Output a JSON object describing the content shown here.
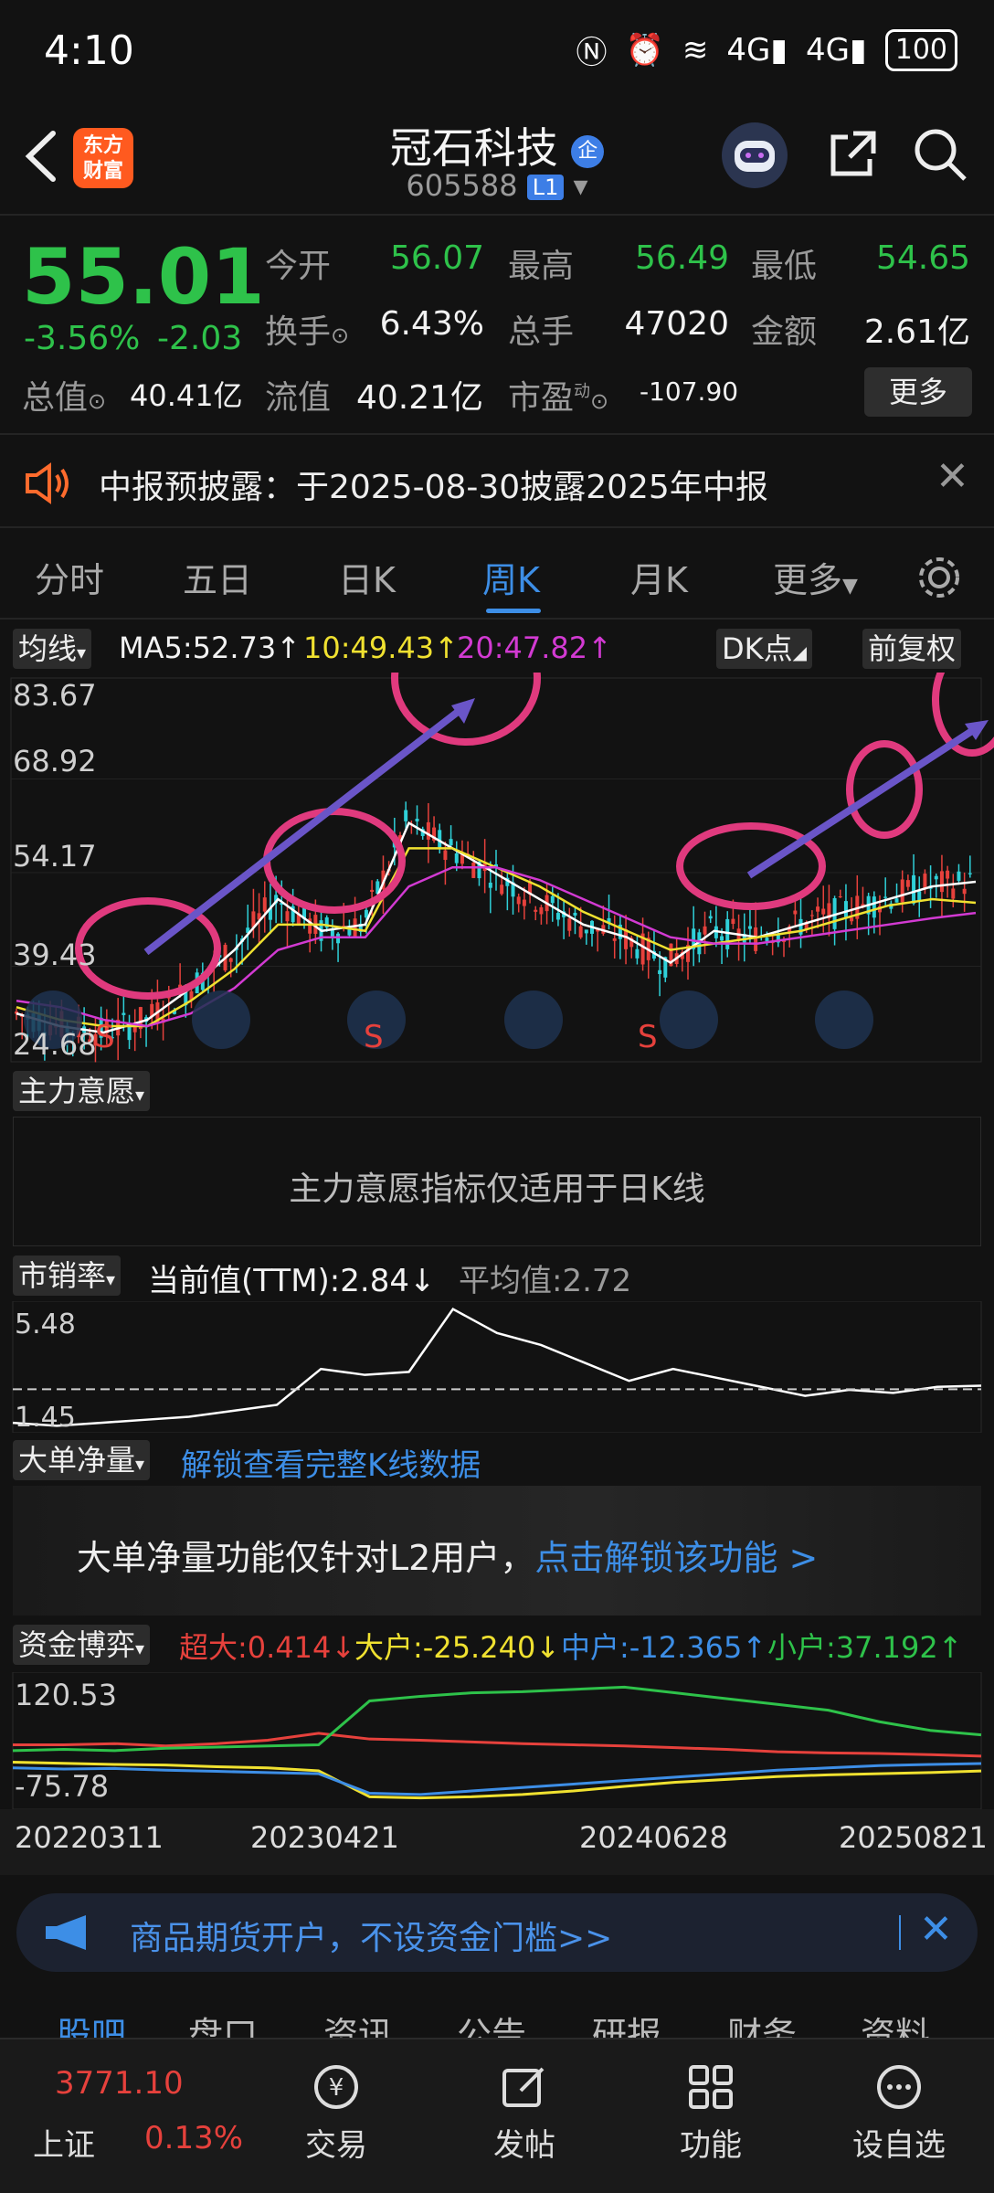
{
  "status": {
    "time": "4:10",
    "battery": "100",
    "network1": "4G",
    "network2": "4G"
  },
  "header": {
    "app_logo": "东方\n财富",
    "stock_name": "冠石科技",
    "stock_badge": "企",
    "stock_code": "605588",
    "level": "L1"
  },
  "quote": {
    "price": "55.01",
    "pct": "-3.56%",
    "change": "-2.03",
    "open_label": "今开",
    "open": "56.07",
    "high_label": "最高",
    "high": "56.49",
    "low_label": "最低",
    "low": "54.65",
    "turnover_label": "换手",
    "turnover": "6.43%",
    "volume_label": "总手",
    "volume": "47020",
    "amount_label": "金额",
    "amount": "2.61亿",
    "mktcap_label": "总值",
    "mktcap": "40.41亿",
    "float_label": "流值",
    "float_cap": "40.21亿",
    "pe_label": "市盈",
    "pe_sup": "动",
    "pe": "-107.90",
    "more": "更多"
  },
  "notice": {
    "text": "中报预披露：于2025-08-30披露2025年中报"
  },
  "tabs": [
    "分时",
    "五日",
    "日K",
    "周K",
    "月K",
    "更多"
  ],
  "chart": {
    "ma_label": "均线",
    "ma5": "MA5:52.73↑",
    "ma10": "10:49.43↑",
    "ma20": "20:47.82↑",
    "dk_label": "DK点",
    "adjust_label": "前复权",
    "y_ticks": [
      "83.67",
      "68.92",
      "54.17",
      "39.43",
      "24.68"
    ],
    "colors": {
      "up": "#e6413c",
      "down": "#2fd0d8",
      "ma5": "#ffffff",
      "ma10": "#f0e130",
      "ma20": "#d23ad2",
      "annotation": "#e03a7e",
      "arrow": "#6a55c8"
    }
  },
  "chart_data": {
    "type": "line",
    "title": "",
    "xlabel": "",
    "ylabel": "",
    "ylim": [
      24.68,
      83.67
    ],
    "series": [
      {
        "name": "MA5",
        "values": [
          32,
          30,
          29,
          31,
          36,
          42,
          50,
          45,
          46,
          62,
          58,
          54,
          50,
          46,
          44,
          40,
          45,
          44,
          46,
          48,
          50,
          52,
          52.73
        ]
      },
      {
        "name": "10",
        "values": [
          33,
          31,
          30,
          30,
          34,
          39,
          46,
          46,
          45,
          58,
          58,
          55,
          52,
          48,
          45,
          42,
          43,
          44,
          45,
          47,
          49,
          50,
          49.43
        ]
      },
      {
        "name": "20",
        "values": [
          34,
          33,
          31,
          30,
          32,
          36,
          42,
          44,
          44,
          52,
          55,
          55,
          53,
          50,
          47,
          44,
          43,
          43,
          44,
          45,
          46,
          47,
          47.82
        ]
      }
    ]
  },
  "zhuli": {
    "label": "主力意愿",
    "message": "主力意愿指标仅适用于日K线"
  },
  "ps": {
    "label": "市销率",
    "current": "当前值(TTM):2.84↓",
    "average": "平均值:2.72",
    "y_top": "5.48",
    "y_bottom": "1.45"
  },
  "ps_data": {
    "values": [
      1.6,
      1.5,
      1.6,
      1.7,
      1.8,
      2.0,
      2.2,
      3.4,
      3.2,
      3.3,
      5.4,
      4.6,
      4.2,
      3.6,
      3.0,
      3.4,
      3.1,
      2.8,
      2.5,
      2.7,
      2.6,
      2.8,
      2.84
    ],
    "average": 2.72
  },
  "bigorder": {
    "label": "大单净量",
    "unlock_link": "解锁查看完整K线数据",
    "message": "大单净量功能仅针对L2用户，",
    "message_link": "点击解锁该功能 >"
  },
  "capital": {
    "label": "资金博弈",
    "super": "超大:0.414↓",
    "large": "大户:-25.240↓",
    "mid": "中户:-12.365↑",
    "small": "小户:37.192↑",
    "y_top": "120.53",
    "y_bottom": "-75.78",
    "dates": [
      "20220311",
      "20230421",
      "20240628",
      "20250821"
    ]
  },
  "capital_data": {
    "series": [
      {
        "name": "超大",
        "values": [
          20,
          20,
          22,
          18,
          22,
          28,
          40,
          30,
          28,
          25,
          22,
          20,
          18,
          15,
          12,
          8,
          6,
          5,
          3,
          0.414
        ]
      },
      {
        "name": "大户",
        "values": [
          -10,
          -12,
          -14,
          -15,
          -18,
          -20,
          -25,
          -70,
          -72,
          -70,
          -66,
          -60,
          -52,
          -45,
          -40,
          -35,
          -32,
          -30,
          -28,
          -25.24
        ]
      },
      {
        "name": "中户",
        "values": [
          -20,
          -22,
          -21,
          -24,
          -26,
          -28,
          -30,
          -64,
          -66,
          -60,
          -54,
          -48,
          -42,
          -36,
          -30,
          -24,
          -20,
          -16,
          -14,
          -12.365
        ]
      },
      {
        "name": "小户",
        "values": [
          10,
          12,
          10,
          14,
          16,
          18,
          20,
          96,
          104,
          110,
          112,
          116,
          120,
          110,
          100,
          90,
          80,
          60,
          45,
          37.192
        ]
      }
    ]
  },
  "promo": {
    "text": "商品期货开户，不设资金门槛>>"
  },
  "subtabs": [
    "股吧",
    "盘口",
    "资讯",
    "公告",
    "研报",
    "财务",
    "资料"
  ],
  "bottom": {
    "index_value": "3771.10",
    "index_name": "上证",
    "index_pct": "0.13%",
    "trade": "交易",
    "post": "发帖",
    "function": "功能",
    "watch": "设自选"
  }
}
